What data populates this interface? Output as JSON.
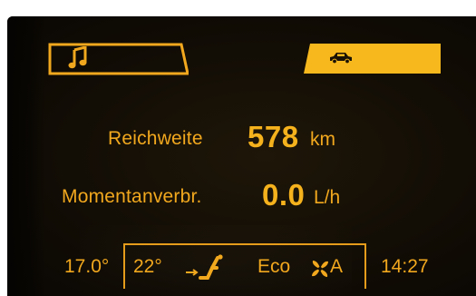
{
  "tabs": {
    "audio_icon": "music-note-icon",
    "car_icon": "car-icon"
  },
  "info": {
    "range_label": "Reichweite",
    "range_value": "578",
    "range_unit": "km",
    "consumption_label": "Momentanverbr.",
    "consumption_value": "0.0",
    "consumption_unit": "L/h"
  },
  "status_bar": {
    "outside_temp": "17.0°",
    "set_temp": "22°",
    "airflow_icon": "seat-airflow-icon",
    "mode": "Eco",
    "fan_icon": "fan-icon",
    "fan_mode": "A",
    "clock": "14:27"
  },
  "colors": {
    "amber": "#f2a81e",
    "tab_active": "#f7b81d",
    "background": "#120d05"
  }
}
